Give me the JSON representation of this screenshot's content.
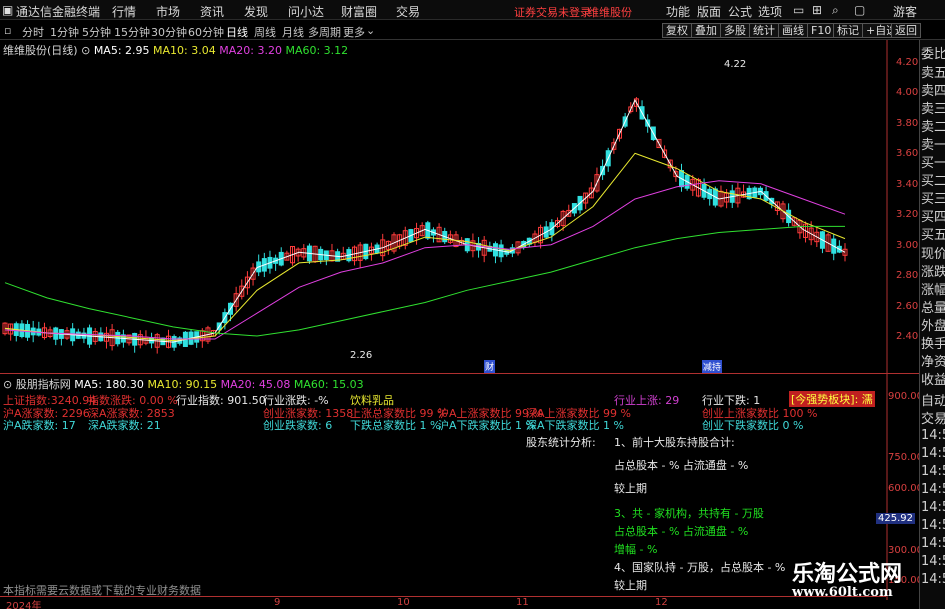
{
  "menubar": {
    "app_title": "通达信金融终端",
    "items": [
      "行情",
      "市场",
      "资讯",
      "发现",
      "问小达",
      "财富圈",
      "交易"
    ],
    "status_notice": "证券交易未登录",
    "stock_name": "维维股份",
    "right_items": [
      "功能",
      "版面",
      "公式",
      "选项"
    ],
    "user": "游客"
  },
  "periods": {
    "items": [
      "分时",
      "1分钟",
      "5分钟",
      "15分钟",
      "30分钟",
      "60分钟",
      "日线",
      "周线",
      "月线",
      "多周期",
      "更多"
    ],
    "active": "日线"
  },
  "toolbar": {
    "buttons": [
      "复权",
      "叠加",
      "多股",
      "统计",
      "画线",
      "F10",
      "标记",
      "+自选",
      "返回"
    ]
  },
  "main_chart": {
    "title": "维维股份(日线)",
    "ma5": "MA5: 2.95",
    "ma10": "MA10: 3.04",
    "ma20": "MA20: 3.20",
    "ma60": "MA60: 3.12",
    "high_label": "4.22",
    "low_label": "2.26",
    "marker_cai": "财",
    "marker_jia": "减持",
    "colors": {
      "up": "#ff3c3c",
      "down": "#30e0e0",
      "ma5": "#ffffff",
      "ma10": "#e8e830",
      "ma20": "#e040e0",
      "ma60": "#30e030"
    }
  },
  "chart_data": {
    "type": "line",
    "title": "维维股份(日线)",
    "yticks": [
      "4.20",
      "4.00",
      "3.80",
      "3.60",
      "3.40",
      "3.20",
      "3.00",
      "2.80",
      "2.60",
      "2.40"
    ],
    "ylim": [
      2.26,
      4.22
    ],
    "xticks": [
      "2024年",
      "9",
      "10",
      "11",
      "12"
    ],
    "series": [
      {
        "name": "MA5",
        "values": [
          2.45,
          2.42,
          2.4,
          2.38,
          2.36,
          2.42,
          2.85,
          2.95,
          2.92,
          2.98,
          3.1,
          3.0,
          2.95,
          3.1,
          3.35,
          3.95,
          3.45,
          3.3,
          3.35,
          3.1,
          2.95
        ]
      },
      {
        "name": "MA10",
        "values": [
          2.45,
          2.42,
          2.41,
          2.39,
          2.37,
          2.4,
          2.7,
          2.88,
          2.9,
          2.95,
          3.05,
          3.02,
          2.96,
          3.05,
          3.25,
          3.6,
          3.5,
          3.35,
          3.3,
          3.15,
          3.04
        ]
      },
      {
        "name": "MA20",
        "values": [
          2.44,
          2.42,
          2.41,
          2.4,
          2.38,
          2.38,
          2.55,
          2.72,
          2.82,
          2.88,
          2.98,
          3.0,
          2.97,
          3.0,
          3.12,
          3.3,
          3.38,
          3.42,
          3.4,
          3.3,
          3.2
        ]
      },
      {
        "name": "MA60",
        "values": [
          2.75,
          2.65,
          2.58,
          2.52,
          2.46,
          2.42,
          2.4,
          2.44,
          2.5,
          2.56,
          2.62,
          2.7,
          2.76,
          2.82,
          2.9,
          2.98,
          3.04,
          3.08,
          3.1,
          3.12,
          3.12
        ]
      }
    ]
  },
  "right_strip": {
    "items": [
      "委比",
      "卖五",
      "卖四",
      "卖三",
      "卖二",
      "卖一",
      "买一",
      "买二",
      "买三",
      "买四",
      "买五",
      "现价",
      "涨跌",
      "涨幅",
      "总量",
      "外盘",
      "换手",
      "净资",
      "收益",
      "自动",
      "交易",
      "14:5",
      "14:5",
      "14:5",
      "14:5",
      "14:5",
      "14:5",
      "14:5",
      "14:5",
      "14:5"
    ]
  },
  "indicator": {
    "title": "股朋指标网",
    "ma5": "MA5: 180.30",
    "ma10": "MA10: 90.15",
    "ma20": "MA20: 45.08",
    "ma60": "MA60: 15.03",
    "yticks": [
      "900.00",
      "750.00",
      "600.00",
      "425.92",
      "300.00",
      "150.00"
    ],
    "strong_sector": "[今强势板块]: 濡",
    "rows": [
      [
        "上证指数:3240.94",
        "指数涨跌: 0.00 %",
        "行业指数: 901.50",
        "行业涨跌: -%",
        "饮料乳品",
        "行业上涨: 29",
        "行业下跌: 1"
      ],
      [
        "沪A涨家数: 2296",
        "深A涨家数: 2853",
        "创业涨家数: 1358",
        "上涨总家数比 99 %",
        "沪A上涨家数比 99 %",
        "深A上涨家数比 99 %",
        "创业上涨家数比 100 %"
      ],
      [
        "沪A跌家数: 17",
        "深A跌家数: 21",
        "创业跌家数: 6",
        "下跌总家数比 1 %",
        "沪A下跌家数比 1 %",
        "深A下跌家数比 1 %",
        "创业下跌家数比 0 %"
      ]
    ],
    "holder_title": "股东统计分析:",
    "holder_lines": [
      "1、前十大股东持股合计:",
      "占总股本 - %   占流通盘 - %",
      "较上期",
      "3、共 - 家机构，共持有 - 万股",
      "占总股本 - %   占流通盘 - %",
      "增幅 - %",
      "4、国家队持 - 万股，占总股本 - %",
      "较上期"
    ],
    "footer_note": "本指标需要云数据或下载的专业财务数据"
  },
  "watermark": {
    "line1": "乐淘公式网",
    "line2": "www.60lt.com"
  }
}
